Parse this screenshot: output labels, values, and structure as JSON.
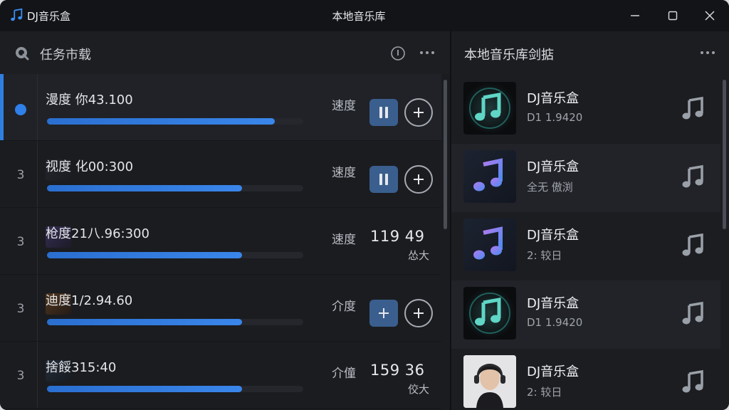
{
  "window": {
    "app_title": "DJ音乐盒",
    "center_title": "本地音乐库",
    "accent_color": "#2f80e8"
  },
  "left_panel": {
    "title": "任务市载",
    "header_icons": [
      "search-icon",
      "info-icon",
      "more-icon"
    ],
    "tasks": [
      {
        "index": "",
        "name": "漫度 你43.100",
        "progress": 0.89,
        "speed_label": "速度",
        "state": "paused",
        "action": "pause",
        "value": "",
        "sub": ""
      },
      {
        "index": "3",
        "name": "视度 化00:300",
        "progress": 0.76,
        "speed_label": "速度",
        "state": "paused",
        "action": "pause",
        "value": "",
        "sub": ""
      },
      {
        "index": "3",
        "name": "枪度21八.96:300",
        "progress": 0.76,
        "speed_label": "速度",
        "state": "running",
        "action": "",
        "value": "119 49",
        "sub": "怂大"
      },
      {
        "index": "3",
        "name": "迪度1/2.94.60",
        "progress": 0.76,
        "speed_label": "介度",
        "state": "queued",
        "action": "add",
        "value": "",
        "sub": ""
      },
      {
        "index": "3",
        "name": "捨餒315:40",
        "progress": 0.76,
        "speed_label": "介僮",
        "state": "running",
        "action": "",
        "value": "159 36",
        "sub": "佼大"
      }
    ]
  },
  "right_panel": {
    "title": "本地音乐库剑掂",
    "items": [
      {
        "name": "DJ音乐盒",
        "sub": "D1 1.9420",
        "cover": "music-note-teal"
      },
      {
        "name": "DJ音乐盒",
        "sub": "全无 傲渕",
        "cover": "music-note-purple"
      },
      {
        "name": "DJ音乐盒",
        "sub": "2: 较日",
        "cover": "music-note-purple"
      },
      {
        "name": "DJ音乐盒",
        "sub": "D1 1.9420",
        "cover": "music-note-teal"
      },
      {
        "name": "DJ音乐盒",
        "sub": "2: 较日",
        "cover": "portrait-photo"
      }
    ]
  }
}
